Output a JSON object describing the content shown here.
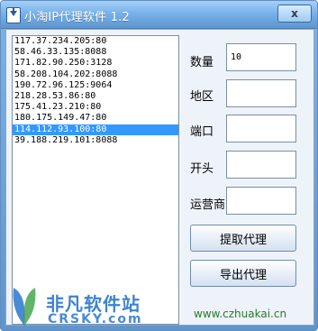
{
  "window": {
    "title": "小淘IP代理软件 1.2",
    "close_label": "x"
  },
  "proxy_list": {
    "items": [
      "117.37.234.205:80",
      "58.46.33.135:8088",
      "171.82.90.250:3128",
      "58.208.104.202:8088",
      "190.72.96.125:9064",
      "218.28.53.86:80",
      "175.41.23.210:80",
      "180.175.149.47:80",
      "114.112.93.100:80",
      "39.188.219.101:8088"
    ],
    "selected_index": 8
  },
  "form": {
    "quantity_label": "数量",
    "quantity_value": "10",
    "region_label": "地区",
    "region_value": "",
    "port_label": "端口",
    "port_value": "",
    "prefix_label": "开头",
    "prefix_value": "",
    "isp_label": "运营商",
    "isp_value": ""
  },
  "buttons": {
    "fetch_label": "提取代理",
    "export_label": "导出代理"
  },
  "footer": {
    "website": "www.czhuakai.cn"
  },
  "watermark": {
    "brand_cn": "非凡软件站",
    "brand_en": "CRSKY.com"
  },
  "colors": {
    "selection": "#3399ff",
    "website_text": "#2a7a2a",
    "watermark": "#1a6ec9"
  }
}
